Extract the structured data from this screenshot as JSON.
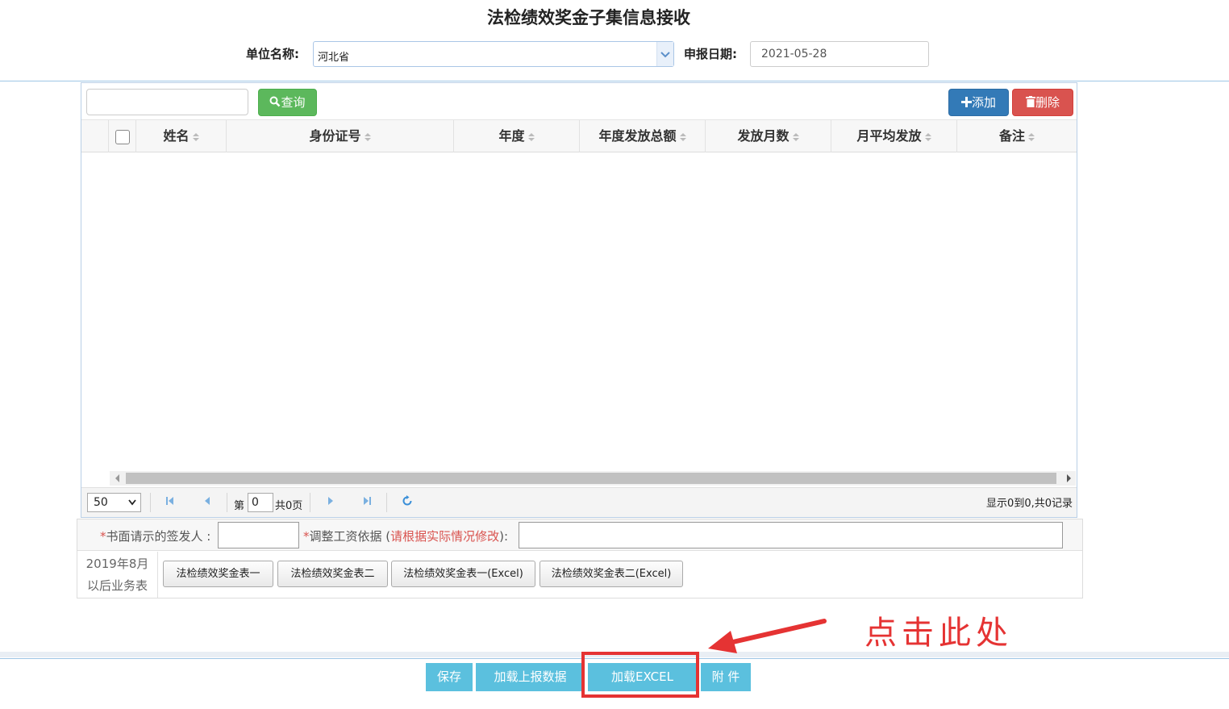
{
  "header": {
    "title": "法检绩效奖金子集信息接收",
    "unit_label": "单位名称:",
    "unit_value": "河北省",
    "date_label": "申报日期:",
    "date_value": "2021-05-28"
  },
  "toolbar": {
    "query_label": "查询",
    "add_label": "添加",
    "delete_label": "删除"
  },
  "table": {
    "columns": [
      "姓名",
      "身份证号",
      "年度",
      "年度发放总额",
      "发放月数",
      "月平均发放",
      "备注"
    ]
  },
  "pager": {
    "page_size": "50",
    "page_prefix": "第",
    "page_number": "0",
    "page_total": "共0页",
    "record_info": "显示0到0,共0记录"
  },
  "form": {
    "signer_star": "*",
    "signer_label": "书面请示的签发人 :",
    "basis_star": "*",
    "basis_label": "调整工资依据 (",
    "basis_hint": "请根据实际情况修改",
    "basis_label_end": "):",
    "row2_label_line1": "2019年8月",
    "row2_label_line2": "以后业务表",
    "buttons": [
      "法检绩效奖金表一",
      "法检绩效奖金表二",
      "法检绩效奖金表一(Excel)",
      "法检绩效奖金表二(Excel)"
    ]
  },
  "bottom": {
    "save_label": "保存",
    "load_report_label": "加载上报数据",
    "load_excel_label": "加载EXCEL",
    "attachment_label": "附 件"
  },
  "annotation": {
    "text": "点击此处",
    "color": "#e53333"
  },
  "colors": {
    "query_green": "#5cb85c",
    "add_blue": "#337ab7",
    "delete_red": "#d9534f",
    "bottom_button": "#5bc0de"
  }
}
